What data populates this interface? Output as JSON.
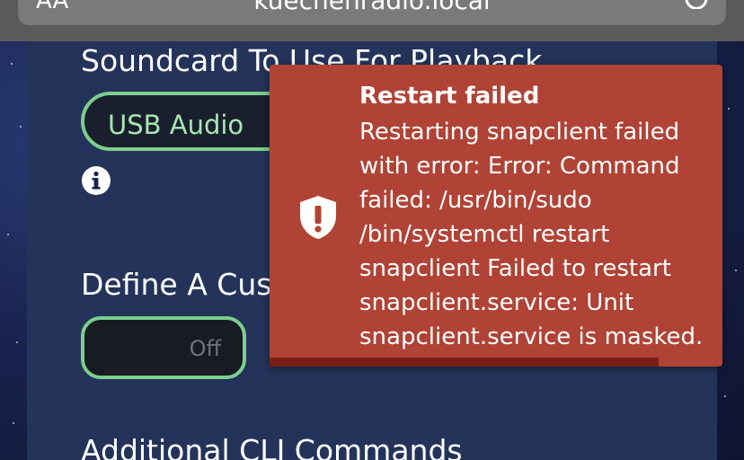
{
  "browser": {
    "aa_label": "AA",
    "url": "kuechenradio.local"
  },
  "settings": {
    "soundcard_title": "Soundcard To Use For Playback",
    "soundcard_value": "USB Audio",
    "custom_title": "Define A Custom Latency",
    "custom_toggle_label": "Off",
    "cli_title": "Additional CLI Commands"
  },
  "toast": {
    "title": "Restart failed",
    "message": "Restarting snapclient failed with error: Error: Command failed: /usr/bin/sudo /bin/systemctl restart snapclient Failed to restart snapclient.service: Unit snapclient.service is masked.",
    "progress_fraction": 0.86
  },
  "colors": {
    "toast_bg": "#b04335",
    "accent_green": "#7ccf8e"
  }
}
